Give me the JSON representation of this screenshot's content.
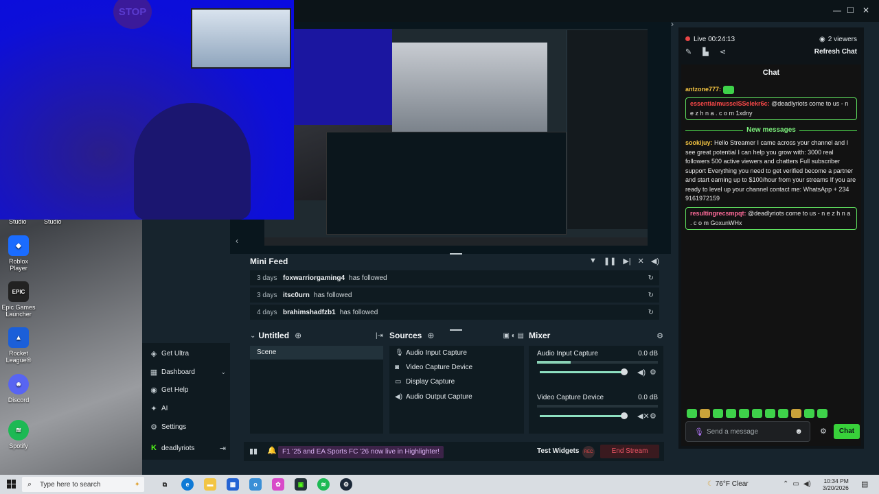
{
  "desktop": {
    "icons": [
      {
        "label": "Roblox Player",
        "icon": "roblox-icon",
        "color": "#1a6cff"
      },
      {
        "label": "Epic Games Launcher",
        "icon": "epic-games-icon",
        "color": "#222222"
      },
      {
        "label": "Rocket League®",
        "icon": "rocket-league-icon",
        "color": "#1b5fd9"
      },
      {
        "label": "Discord",
        "icon": "discord-icon",
        "color": "#5865f2"
      },
      {
        "label": "Spotify",
        "icon": "spotify-icon",
        "color": "#1db954"
      }
    ],
    "top_labels": [
      "Studio",
      "Studio"
    ]
  },
  "webcam": {
    "sign_text": "STOP"
  },
  "nav": {
    "items": [
      {
        "label": "Get Ultra",
        "icon": "ultra-icon"
      },
      {
        "label": "Dashboard",
        "icon": "dashboard-icon"
      },
      {
        "label": "Get Help",
        "icon": "help-icon"
      },
      {
        "label": "AI",
        "icon": "ai-sparkle-icon"
      },
      {
        "label": "Settings",
        "icon": "gear-icon"
      },
      {
        "label": "deadlyriots",
        "icon": "kick-icon"
      }
    ]
  },
  "minifeed": {
    "title": "Mini Feed",
    "rows": [
      {
        "ago": "3 days",
        "user": "foxwarriorgaming4",
        "action": "has followed"
      },
      {
        "ago": "3 days",
        "user": "itsc0urn",
        "action": "has followed"
      },
      {
        "ago": "4 days",
        "user": "brahimshadfzb1",
        "action": "has followed"
      }
    ]
  },
  "scenes": {
    "title": "Untitled",
    "items": [
      "Scene"
    ]
  },
  "sources": {
    "title": "Sources",
    "items": [
      {
        "label": "Audio Input Capture",
        "icon": "microphone-icon"
      },
      {
        "label": "Video Capture Device",
        "icon": "camera-icon"
      },
      {
        "label": "Display Capture",
        "icon": "monitor-icon"
      },
      {
        "label": "Audio Output Capture",
        "icon": "speaker-icon"
      }
    ]
  },
  "mixer": {
    "title": "Mixer",
    "items": [
      {
        "label": "Audio Input Capture",
        "db": "0.0 dB",
        "level": 0.28
      },
      {
        "label": "Video Capture Device",
        "db": "0.0 dB",
        "level": 0.0
      }
    ]
  },
  "bottom": {
    "promo": "F1 '25 and EA Sports FC '26 now live in Highlighter!",
    "test_widgets": "Test Widgets",
    "rec": "REC",
    "end_stream": "End Stream"
  },
  "chat": {
    "live": "Live 00:24:13",
    "viewers": "2 viewers",
    "refresh": "Refresh Chat",
    "title": "Chat",
    "new_messages": "New messages",
    "messages": [
      {
        "user": "antzone777:",
        "text": "",
        "color": "#f5c542"
      },
      {
        "user": "essentialmusselSSelekr6c:",
        "text": "@deadlyriots come to us - n e z h n a . c o m 1xdny",
        "color": "#ff4a4a"
      },
      {
        "user": "sookijuy:",
        "text": "Hello Streamer I came across your channel and I see great potential I can help you grow with: 3000 real followers 500 active viewers and chatters Full subscriber support Everything you need to get verified become a partner and start earning up to $100/hour from your streams If you are ready to level up your channel contact me: WhatsApp + 234 9161972159",
        "color": "#f5c542"
      },
      {
        "user": "resultingrecsmpqt:",
        "text": "@deadlyriots come to us - n e z h n a . c o m GoxunWHx",
        "color": "#ff6b9a"
      }
    ],
    "input_placeholder": "Send a message",
    "send": "Chat"
  },
  "taskbar": {
    "search_placeholder": "Type here to search",
    "weather": "76°F  Clear",
    "time": "10:34 PM",
    "date": "3/20/2026"
  }
}
